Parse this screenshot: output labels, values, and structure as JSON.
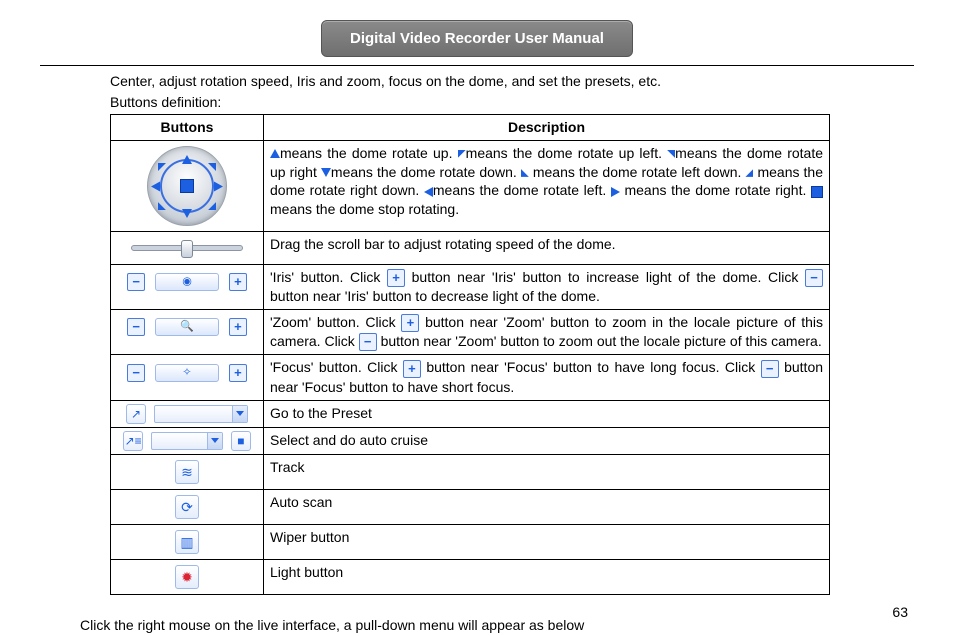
{
  "header": {
    "title": "Digital Video Recorder User Manual"
  },
  "intro": {
    "line1": "Center, adjust rotation speed, Iris and zoom, focus on the dome, and set the presets, etc.",
    "line2": "Buttons definition:"
  },
  "table": {
    "head": {
      "buttons": "Buttons",
      "description": "Description"
    },
    "rows": {
      "dpad": {
        "t1": "means the dome rotate up.  ",
        "t2": "means the dome   rotate up left.  ",
        "t3": "means the dome rotate up right   ",
        "t4": "means the dome rotate down.  ",
        "t5": " means the dome  rotate left down.  ",
        "t6": " means the dome  rotate right down.  ",
        "t7": "means the dome rotate left.  ",
        "t8": " means the dome rotate right.  ",
        "t9": "means the dome stop rotating."
      },
      "slider": {
        "desc": "Drag the scroll bar to adjust rotating speed of the dome."
      },
      "iris": {
        "p1": "'Iris' button. Click  ",
        "p2": "button near 'Iris' button to increase light of the dome. Click  ",
        "p3": " button near 'Iris' button to decrease light of the dome."
      },
      "zoom": {
        "p1": "'Zoom' button. Click  ",
        "p2": "button near 'Zoom' button to zoom in the locale picture of this camera. Click  ",
        "p3": "button near 'Zoom' button to zoom out the locale picture of this camera."
      },
      "focus": {
        "p1": "'Focus' button. Click  ",
        "p2": "button near 'Focus' button to have long focus. Click  ",
        "p3": " button near 'Focus' button to have short focus."
      },
      "preset": {
        "desc": "Go to the Preset"
      },
      "cruise": {
        "desc": "Select and do auto cruise"
      },
      "track": {
        "desc": "Track"
      },
      "autoscan": {
        "desc": "Auto scan"
      },
      "wiper": {
        "desc": "Wiper button"
      },
      "light": {
        "desc": "Light button"
      }
    }
  },
  "footer": {
    "text": "Click the right mouse on the live interface, a pull-down menu will appear as below"
  },
  "page_number": "63"
}
